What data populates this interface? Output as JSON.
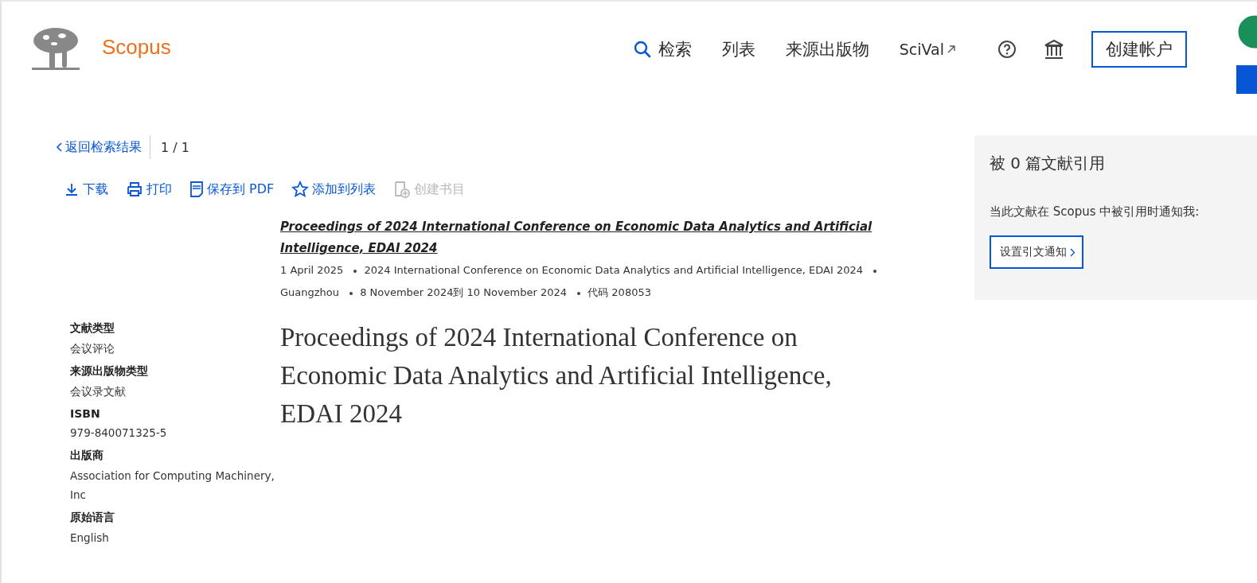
{
  "header": {
    "logo": "Scopus",
    "nav": [
      {
        "kind": "search",
        "label": "检索"
      },
      {
        "kind": "plain",
        "label": "列表"
      },
      {
        "kind": "plain",
        "label": "来源出版物"
      },
      {
        "kind": "external",
        "label": "SciVal"
      }
    ],
    "account_button": "创建帐户"
  },
  "back_link": "返回检索结果",
  "pager": "1 / 1",
  "actions": [
    {
      "kind": "download",
      "label": "下载",
      "disabled": false
    },
    {
      "kind": "print",
      "label": "打印",
      "disabled": false
    },
    {
      "kind": "pdf",
      "label": "保存到 PDF",
      "disabled": false
    },
    {
      "kind": "star",
      "label": "添加到列表",
      "disabled": false
    },
    {
      "kind": "bibliography",
      "label": "创建书目",
      "disabled": true
    }
  ],
  "source": {
    "title": "Proceedings of 2024 International Conference on Economic Data Analytics and Artificial Intelligence, EDAI 2024",
    "details": [
      "1 April 2025",
      "2024 International Conference on Economic Data Analytics and Artificial Intelligence, EDAI 2024",
      "Guangzhou",
      "8 November 2024到 10 November 2024",
      "代码 208053"
    ]
  },
  "document_title": "Proceedings of 2024 International Conference on Economic Data Analytics and Artificial Intelligence, EDAI 2024",
  "sidebar": [
    {
      "label": "文献类型",
      "value": "会议评论"
    },
    {
      "label": "来源出版物类型",
      "value": "会议录文献"
    },
    {
      "label": "ISBN",
      "value": "979-840071325-5"
    },
    {
      "label": "出版商",
      "value": "Association for Computing Machinery, Inc"
    },
    {
      "label": "原始语言",
      "value": "English"
    }
  ],
  "citations": {
    "heading": "被 0 篇文献引用",
    "prompt": "当此文献在 Scopus 中被引用时通知我:",
    "button": "设置引文通知"
  }
}
